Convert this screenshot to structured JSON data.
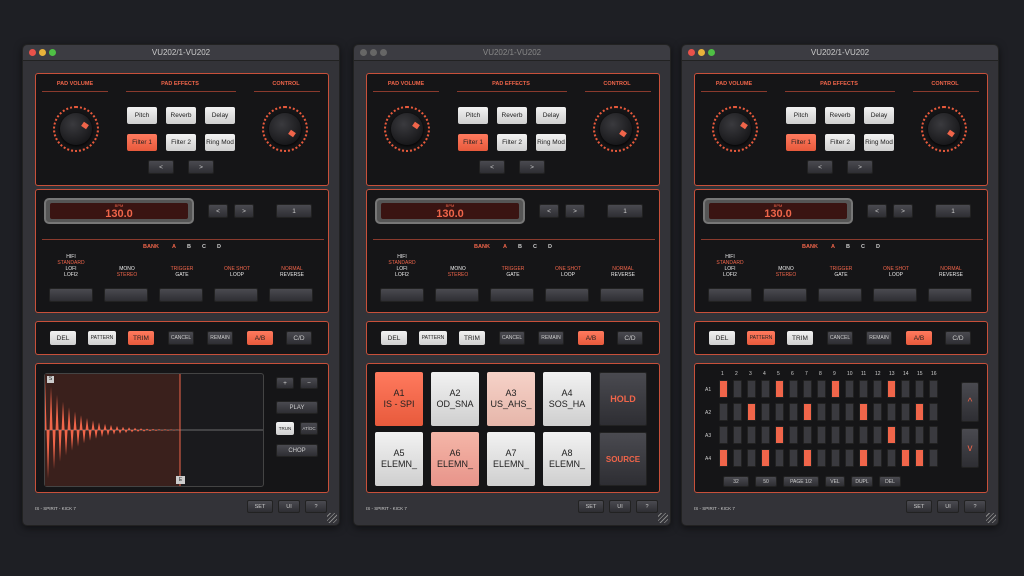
{
  "window_title": "VU202/1-VU202",
  "labels": {
    "pad_volume": "PAD VOLUME",
    "pad_effects": "PAD EFFECTS",
    "control": "CONTROL",
    "bpm_caption": "BPM",
    "bank": "BANK"
  },
  "effects": [
    "Pitch",
    "Reverb",
    "Delay",
    "Filter 1",
    "Filter 2",
    "Ring Mod"
  ],
  "nav": {
    "prev": "<",
    "next": ">"
  },
  "bpm": {
    "value": "130.0",
    "step": "1"
  },
  "banks": [
    "A",
    "B",
    "C",
    "D"
  ],
  "modes": {
    "quality": [
      "HIFI",
      "STANDARD",
      "LOFI",
      "LOFI2"
    ],
    "mono": [
      "MONO",
      "STEREO"
    ],
    "trigger": [
      "TRIGGER",
      "GATE"
    ],
    "shot": [
      "ONE SHOT",
      "LOOP"
    ],
    "dir": [
      "NORMAL",
      "REVERSE"
    ]
  },
  "toolbar": [
    "DEL",
    "PATTERN",
    "TRIM",
    "CANCEL",
    "REMAIN",
    "A/B",
    "C/D"
  ],
  "trim_panel": {
    "plus": "+",
    "minus": "−",
    "play": "PLAY",
    "trun": "TRUN",
    "atdc": "AT/DC",
    "chop": "CHOP",
    "marker_s": "S",
    "marker_e": "E"
  },
  "pads": [
    {
      "id": "A1",
      "name": "IS - SPI"
    },
    {
      "id": "A2",
      "name": "OD_SNA"
    },
    {
      "id": "A3",
      "name": "US_AHS_"
    },
    {
      "id": "A4",
      "name": "SOS_HA"
    },
    {
      "id": "A5",
      "name": "ELEMN_"
    },
    {
      "id": "A6",
      "name": "ELEMN_"
    },
    {
      "id": "A7",
      "name": "ELEMN_"
    },
    {
      "id": "A8",
      "name": "ELEMN_"
    }
  ],
  "pad_side": {
    "hold": "HOLD",
    "source": "SOURCE"
  },
  "sequencer": {
    "rows": [
      "A1",
      "A2",
      "A3",
      "A4"
    ],
    "steps": [
      "1",
      "2",
      "3",
      "4",
      "5",
      "6",
      "7",
      "8",
      "9",
      "10",
      "11",
      "12",
      "13",
      "14",
      "15",
      "16"
    ],
    "pattern": [
      [
        1,
        0,
        0,
        0,
        1,
        0,
        0,
        0,
        1,
        0,
        0,
        0,
        1,
        0,
        0,
        0
      ],
      [
        0,
        0,
        1,
        0,
        0,
        0,
        1,
        0,
        0,
        0,
        1,
        0,
        0,
        0,
        1,
        0
      ],
      [
        0,
        0,
        0,
        0,
        1,
        0,
        0,
        0,
        0,
        0,
        0,
        0,
        1,
        0,
        0,
        0
      ],
      [
        1,
        0,
        0,
        1,
        0,
        0,
        1,
        0,
        0,
        0,
        1,
        0,
        0,
        1,
        1,
        0
      ]
    ],
    "buttons": [
      "32",
      "50",
      "PAGE 1/2",
      "VEL",
      "DUPL",
      "DEL"
    ],
    "up": "^",
    "down": "v"
  },
  "status_text": "IS - SPIRIT - KICK 7",
  "footer": {
    "set": "SET",
    "ui": "UI",
    "help": "?"
  },
  "colors": {
    "accent": "#f0654a",
    "panel": "#151517",
    "window": "#333338"
  }
}
